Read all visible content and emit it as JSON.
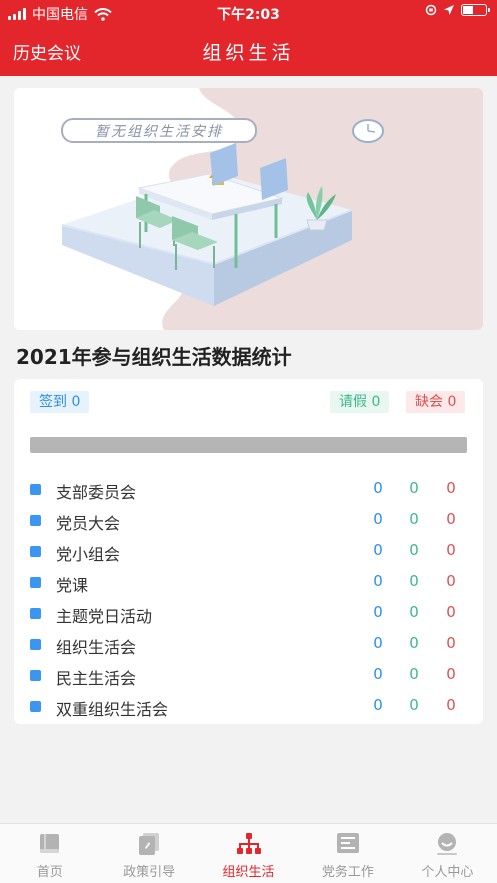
{
  "status_bar": {
    "carrier": "中国电信",
    "time": "下午2:03"
  },
  "header": {
    "left_link": "历史会议",
    "title": "组织生活"
  },
  "banner": {
    "text": "暂无组织生活安排"
  },
  "stats": {
    "title": "2021年参与组织生活数据统计",
    "chips": {
      "sign_in": "签到 0",
      "leave": "请假 0",
      "absent": "缺会 0"
    },
    "progress": {
      "sign_in": 0,
      "leave": 0,
      "absent": 0
    },
    "rows": [
      {
        "name": "支部委员会",
        "sign_in": "0",
        "leave": "0",
        "absent": "0"
      },
      {
        "name": "党员大会",
        "sign_in": "0",
        "leave": "0",
        "absent": "0"
      },
      {
        "name": "党小组会",
        "sign_in": "0",
        "leave": "0",
        "absent": "0"
      },
      {
        "name": "党课",
        "sign_in": "0",
        "leave": "0",
        "absent": "0"
      },
      {
        "name": "主题党日活动",
        "sign_in": "0",
        "leave": "0",
        "absent": "0"
      },
      {
        "name": "组织生活会",
        "sign_in": "0",
        "leave": "0",
        "absent": "0"
      },
      {
        "name": "民主生活会",
        "sign_in": "0",
        "leave": "0",
        "absent": "0"
      },
      {
        "name": "双重组织生活会",
        "sign_in": "0",
        "leave": "0",
        "absent": "0"
      }
    ]
  },
  "tabbar": {
    "items": [
      {
        "label": "首页",
        "icon": "book-icon"
      },
      {
        "label": "政策引导",
        "icon": "policy-icon"
      },
      {
        "label": "组织生活",
        "icon": "org-chart-icon",
        "active": true
      },
      {
        "label": "党务工作",
        "icon": "document-icon"
      },
      {
        "label": "个人中心",
        "icon": "person-icon"
      }
    ]
  },
  "colors": {
    "brand": "#e3252c",
    "sign_in": "#2e8fe6",
    "leave": "#3db88a",
    "absent": "#e0504f",
    "tab_inactive": "#999999"
  }
}
